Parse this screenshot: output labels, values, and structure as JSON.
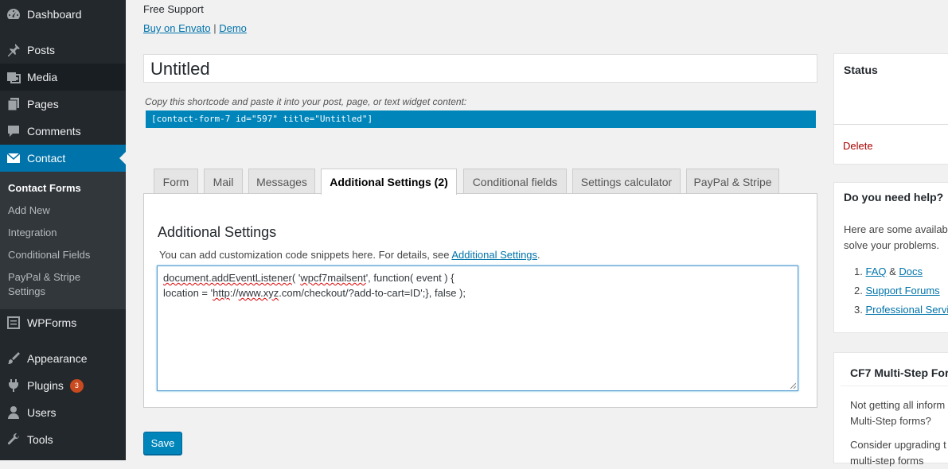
{
  "sidebar": {
    "items": [
      {
        "label": "Dashboard",
        "icon": "dashboard-icon"
      },
      {
        "label": "Posts",
        "icon": "pin-icon"
      },
      {
        "label": "Media",
        "icon": "media-icon"
      },
      {
        "label": "Pages",
        "icon": "pages-icon"
      },
      {
        "label": "Comments",
        "icon": "comments-icon"
      },
      {
        "label": "Contact",
        "icon": "mail-icon"
      },
      {
        "label": "WPForms",
        "icon": "wpforms-icon"
      },
      {
        "label": "Appearance",
        "icon": "brush-icon"
      },
      {
        "label": "Plugins",
        "icon": "plugin-icon",
        "badge": "3"
      },
      {
        "label": "Users",
        "icon": "user-icon"
      },
      {
        "label": "Tools",
        "icon": "wrench-icon"
      }
    ],
    "submenu": [
      "Contact Forms",
      "Add New",
      "Integration",
      "Conditional Fields",
      "PayPal & Stripe",
      "Settings"
    ]
  },
  "header": {
    "support": "Free Support",
    "link_envato": "Buy on Envato",
    "separator": "|",
    "link_demo": "Demo"
  },
  "form": {
    "title_value": "Untitled",
    "shortcode_hint": "Copy this shortcode and paste it into your post, page, or text widget content:",
    "shortcode": "[contact-form-7 id=\"597\" title=\"Untitled\"]"
  },
  "tabs": [
    "Form",
    "Mail",
    "Messages",
    "Additional Settings (2)",
    "Conditional fields",
    "Settings calculator",
    "PayPal & Stripe"
  ],
  "panel": {
    "title": "Additional Settings",
    "desc": "You can add customization code snippets here. For details, see ",
    "desc_link": "Additional Settings",
    "desc_end": ".",
    "code": {
      "l1a": "document.addEventListener",
      "l1b": "( '",
      "l1c": "wpcf7mailsent",
      "l1d": "', function( event ) {",
      "l2a": "location = '",
      "l2b": "http",
      "l2c": "://",
      "l2d": "www.xyz",
      "l2e": ".com/checkout/?add-to-cart=ID';}, false );"
    }
  },
  "save_label": "Save",
  "status_box": {
    "title": "Status",
    "delete": "Delete"
  },
  "help_box": {
    "title": "Do you need help?",
    "text1": "Here are some availab",
    "text2": "solve your problems.",
    "faq": "FAQ",
    "amp": " & ",
    "docs": "Docs",
    "n1": "1. ",
    "n2": "2. ",
    "n3": "3. ",
    "support": "Support Forums",
    "pro": "Professional Servic"
  },
  "cf7_box": {
    "title": "CF7 Multi-Step Forr",
    "t1": "Not getting all inform",
    "t2": "Multi-Step forms?",
    "t3": "Consider upgrading t",
    "t4": "multi-step forms"
  },
  "colors": {
    "accent": "#0073aa",
    "button": "#0085ba",
    "sidebar": "#23282d",
    "delete": "#a00"
  }
}
